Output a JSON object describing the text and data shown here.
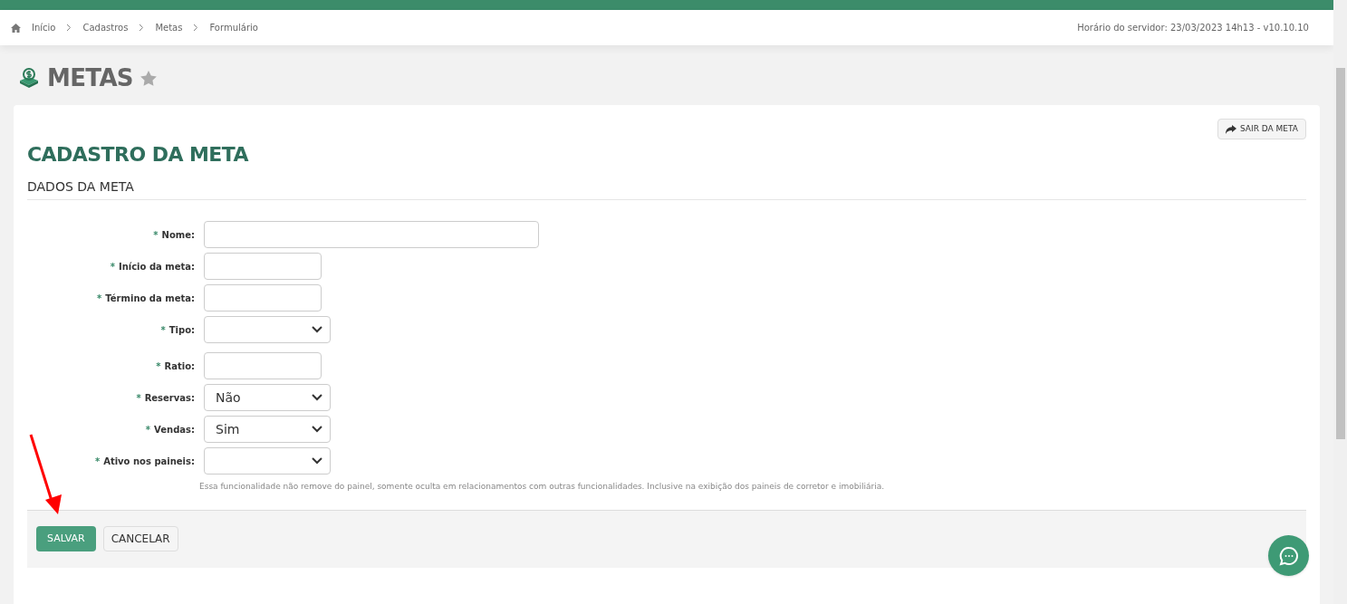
{
  "breadcrumb": [
    "Início",
    "Cadastros",
    "Metas",
    "Formulário"
  ],
  "server_time": "Horário do servidor: 23/03/2023 14h13 - v10.10.10",
  "page_title": "METAS",
  "favorite": false,
  "exit_button": "SAIR DA META",
  "form_title": "CADASTRO DA META",
  "section_title": "DADOS DA META",
  "fields": [
    {
      "kind": "wide",
      "label": "Nome:"
    },
    {
      "kind": "text",
      "label": "Início da meta:"
    },
    {
      "kind": "text",
      "label": "Término da meta:"
    },
    {
      "kind": "select",
      "label": "Tipo:"
    },
    {
      "kind": "text",
      "label": "Ratio:"
    },
    {
      "kind": "select",
      "label": "Reservas:",
      "value": "Não"
    },
    {
      "kind": "select",
      "label": "Vendas:",
      "value": "Sim"
    },
    {
      "kind": "select",
      "label": "Ativo nos paineis:"
    }
  ],
  "required_mark": "*",
  "help_text": "Essa funcionalidade não remove do painel, somente oculta em relacionamentos com outras funcionalidades. Inclusive na exibição dos paineis de corretor e imobiliária.",
  "buttons": [
    {
      "label": "SALVAR",
      "kind": "primary"
    },
    {
      "label": "CANCELAR",
      "kind": "secondary"
    }
  ]
}
